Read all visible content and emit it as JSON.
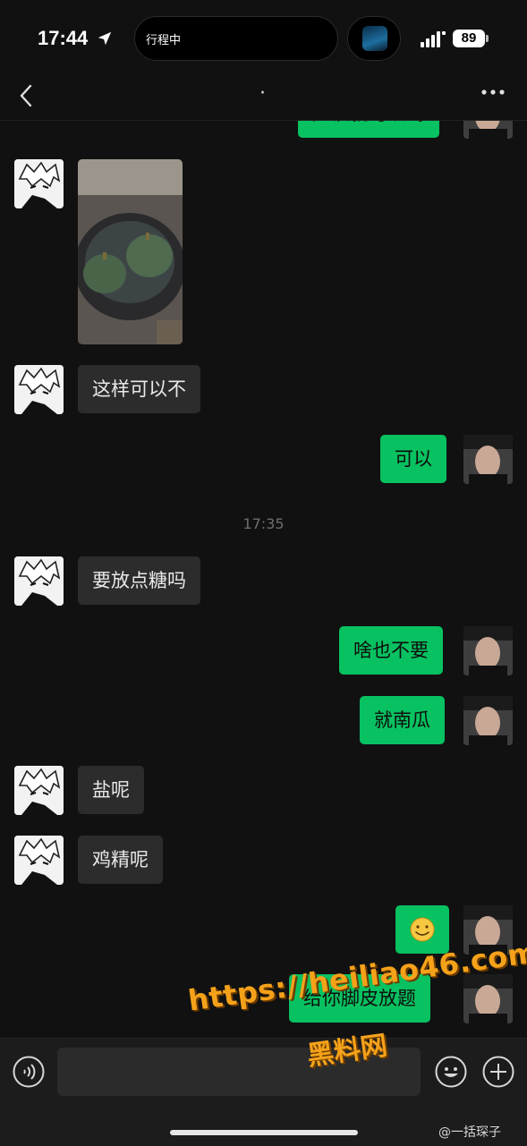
{
  "status_bar": {
    "time": "17:44",
    "island_label": "行程中",
    "battery": "89",
    "icons": [
      "location-arrow-icon",
      "signal-icon"
    ]
  },
  "nav": {
    "title": "·",
    "icons": [
      "back-chevron-icon",
      "more-dots-icon"
    ]
  },
  "messages": [
    {
      "side": "right",
      "text": "应该就可以吗",
      "partial": true
    },
    {
      "side": "left",
      "type": "image",
      "description_icon": "photo-pumpkins"
    },
    {
      "side": "left",
      "text": "这样可以不"
    },
    {
      "side": "right",
      "text": "可以"
    },
    {
      "type": "timestamp",
      "text": "17:35"
    },
    {
      "side": "left",
      "text": "要放点糖吗"
    },
    {
      "side": "right",
      "text": "啥也不要"
    },
    {
      "side": "right",
      "text": "就南瓜"
    },
    {
      "side": "left",
      "text": "盐呢"
    },
    {
      "side": "left",
      "text": "鸡精呢"
    },
    {
      "side": "right",
      "text": "🙂",
      "type": "emoji"
    },
    {
      "side": "right",
      "text": "给你脚皮放题",
      "partial": true
    }
  ],
  "input_bar": {
    "placeholder": "",
    "icons": [
      "voice-icon",
      "emoji-icon",
      "plus-icon"
    ]
  },
  "watermark": {
    "url": "https://heiliao46.com",
    "name": "黑料网",
    "weibo": "@一括琛子"
  },
  "colors": {
    "background": "#111111",
    "left_bubble": "#2c2c2c",
    "right_bubble": "#08c160",
    "watermark": "#f5a21a"
  }
}
